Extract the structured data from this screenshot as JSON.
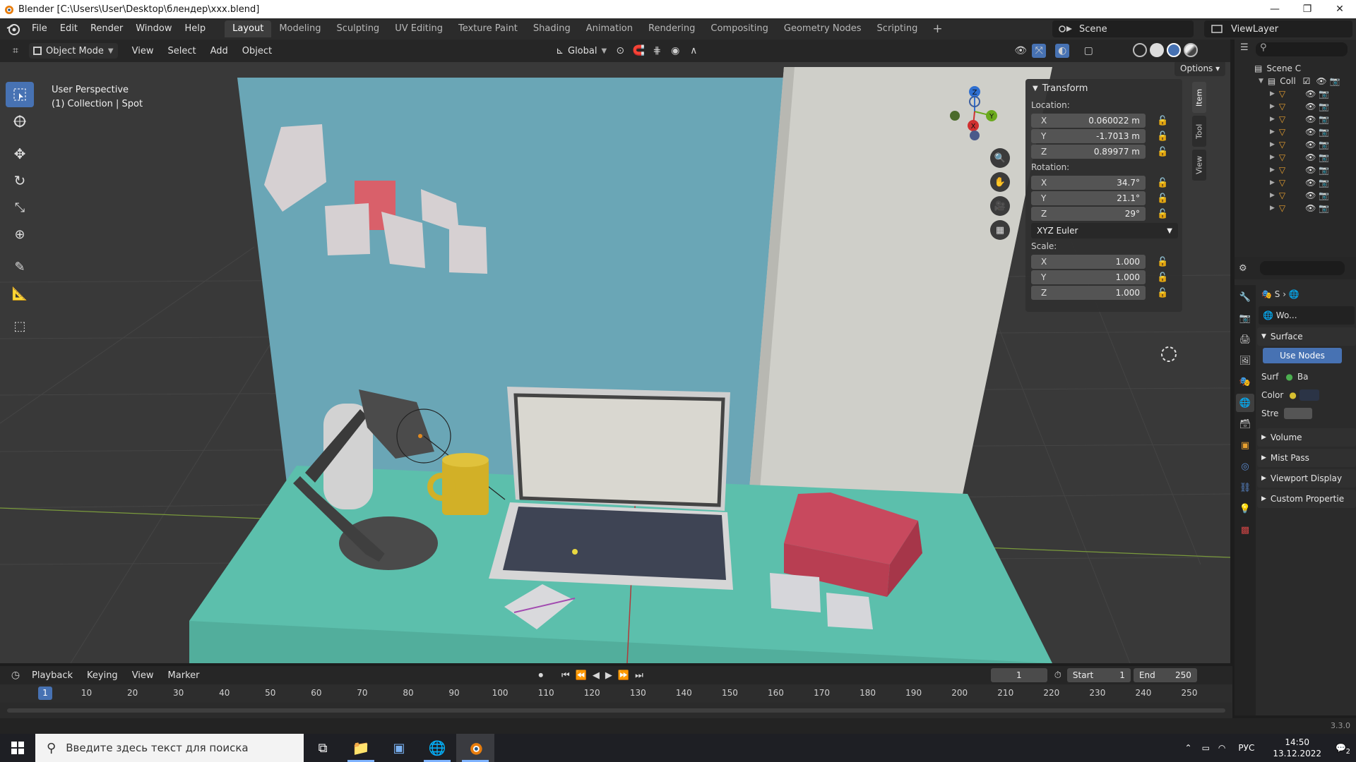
{
  "window": {
    "title": "Blender [C:\\Users\\User\\Desktop\\блендер\\xxx.blend]",
    "controls": [
      "minimize-icon",
      "restore-icon",
      "close-icon"
    ]
  },
  "menubar": {
    "menus": [
      "File",
      "Edit",
      "Render",
      "Window",
      "Help"
    ],
    "workspaces": [
      "Layout",
      "Modeling",
      "Sculpting",
      "UV Editing",
      "Texture Paint",
      "Shading",
      "Animation",
      "Rendering",
      "Compositing",
      "Geometry Nodes",
      "Scripting"
    ],
    "active_workspace": "Layout",
    "scene": "Scene",
    "view_layer": "ViewLayer"
  },
  "viewport_header": {
    "mode": "Object Mode",
    "menus": [
      "View",
      "Select",
      "Add",
      "Object"
    ],
    "orientation": "Global",
    "options_label": "Options"
  },
  "viewport": {
    "overlay_line1": "User Perspective",
    "overlay_line2": "(1) Collection | Spot",
    "gizmo_axes": [
      "Z",
      "Y",
      "X"
    ]
  },
  "npanel": {
    "section": "Transform",
    "location_label": "Location:",
    "location": [
      {
        "axis": "X",
        "value": "0.060022 m"
      },
      {
        "axis": "Y",
        "value": "-1.7013 m"
      },
      {
        "axis": "Z",
        "value": "0.89977 m"
      }
    ],
    "rotation_label": "Rotation:",
    "rotation": [
      {
        "axis": "X",
        "value": "34.7°"
      },
      {
        "axis": "Y",
        "value": "21.1°"
      },
      {
        "axis": "Z",
        "value": "29°"
      }
    ],
    "rotation_mode": "XYZ Euler",
    "scale_label": "Scale:",
    "scale": [
      {
        "axis": "X",
        "value": "1.000"
      },
      {
        "axis": "Y",
        "value": "1.000"
      },
      {
        "axis": "Z",
        "value": "1.000"
      }
    ],
    "tabs": [
      "Item",
      "Tool",
      "View"
    ]
  },
  "outliner": {
    "scene_label": "Scene C",
    "collection_label": "Coll"
  },
  "properties": {
    "breadcrumb_s": "S",
    "world_name": "Wo...",
    "surface_label": "Surface",
    "use_nodes_label": "Use Nodes",
    "surf_label": "Surf",
    "surf_value": "Ba",
    "color_label": "Color",
    "strength_label": "Stre",
    "panels": [
      "Volume",
      "Mist Pass",
      "Viewport Display",
      "Custom Propertie"
    ]
  },
  "timeline": {
    "menus": [
      "Playback",
      "Keying",
      "View",
      "Marker"
    ],
    "current_frame": "1",
    "start_label": "Start",
    "start_value": "1",
    "end_label": "End",
    "end_value": "250",
    "ticks": [
      "1",
      "10",
      "20",
      "30",
      "40",
      "50",
      "60",
      "70",
      "80",
      "90",
      "100",
      "110",
      "120",
      "130",
      "140",
      "150",
      "160",
      "170",
      "180",
      "190",
      "200",
      "210",
      "220",
      "230",
      "240",
      "250"
    ],
    "playhead": "1"
  },
  "statusbar": {
    "version": "3.3.0"
  },
  "taskbar": {
    "search_placeholder": "Введите здесь текст для поиска",
    "lang": "РУС",
    "time": "14:50",
    "date": "13.12.2022",
    "notifications": "2"
  },
  "colors": {
    "accent": "#4772b3",
    "wall": "#6ba6b7",
    "desk": "#5cbfac",
    "box": "#cc4e63",
    "mug": "#d4b52a"
  }
}
